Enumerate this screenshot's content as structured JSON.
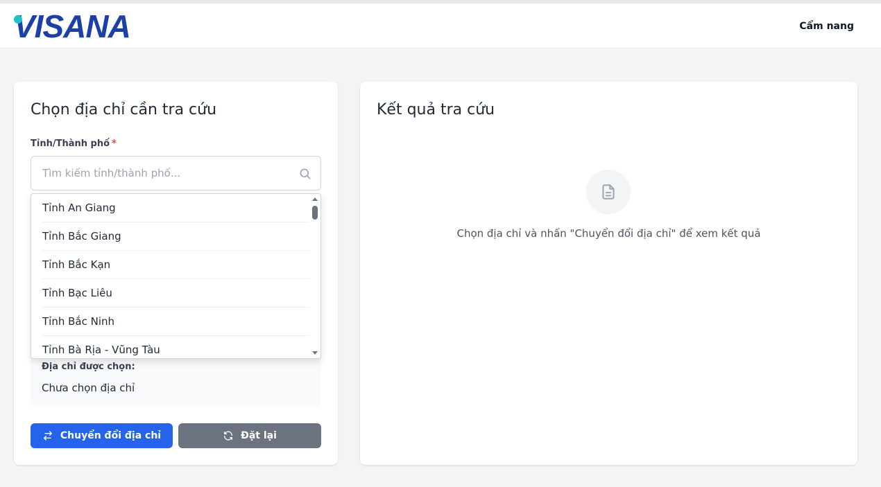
{
  "header": {
    "logo_text": "VISANA",
    "nav_link": "Cẩm nang"
  },
  "left_card": {
    "title": "Chọn địa chỉ cần tra cứu",
    "province_label": "Tỉnh/Thành phố",
    "required_mark": "*",
    "search_placeholder": "Tìm kiếm tỉnh/thành phố...",
    "search_value": "",
    "dropdown_items": [
      "Tỉnh An Giang",
      "Tỉnh Bắc Giang",
      "Tỉnh Bắc Kạn",
      "Tỉnh Bạc Liêu",
      "Tỉnh Bắc Ninh",
      "Tỉnh Bà Rịa - Vũng Tàu"
    ],
    "selected_label": "Địa chỉ được chọn:",
    "selected_value": "Chưa chọn địa chỉ",
    "convert_button": "Chuyển đổi địa chỉ",
    "reset_button": "Đặt lại"
  },
  "right_card": {
    "title": "Kết quả tra cứu",
    "empty_message": "Chọn địa chỉ và nhấn \"Chuyển đổi địa chỉ\" để xem kết quả"
  },
  "colors": {
    "primary": "#2563eb",
    "secondary": "#6b7280",
    "logo": "#1d3fa8",
    "logo_accent": "#22c1c3",
    "required": "#ef4444"
  },
  "icons": [
    "search-icon",
    "swap-arrows-icon",
    "refresh-icon",
    "document-icon"
  ]
}
